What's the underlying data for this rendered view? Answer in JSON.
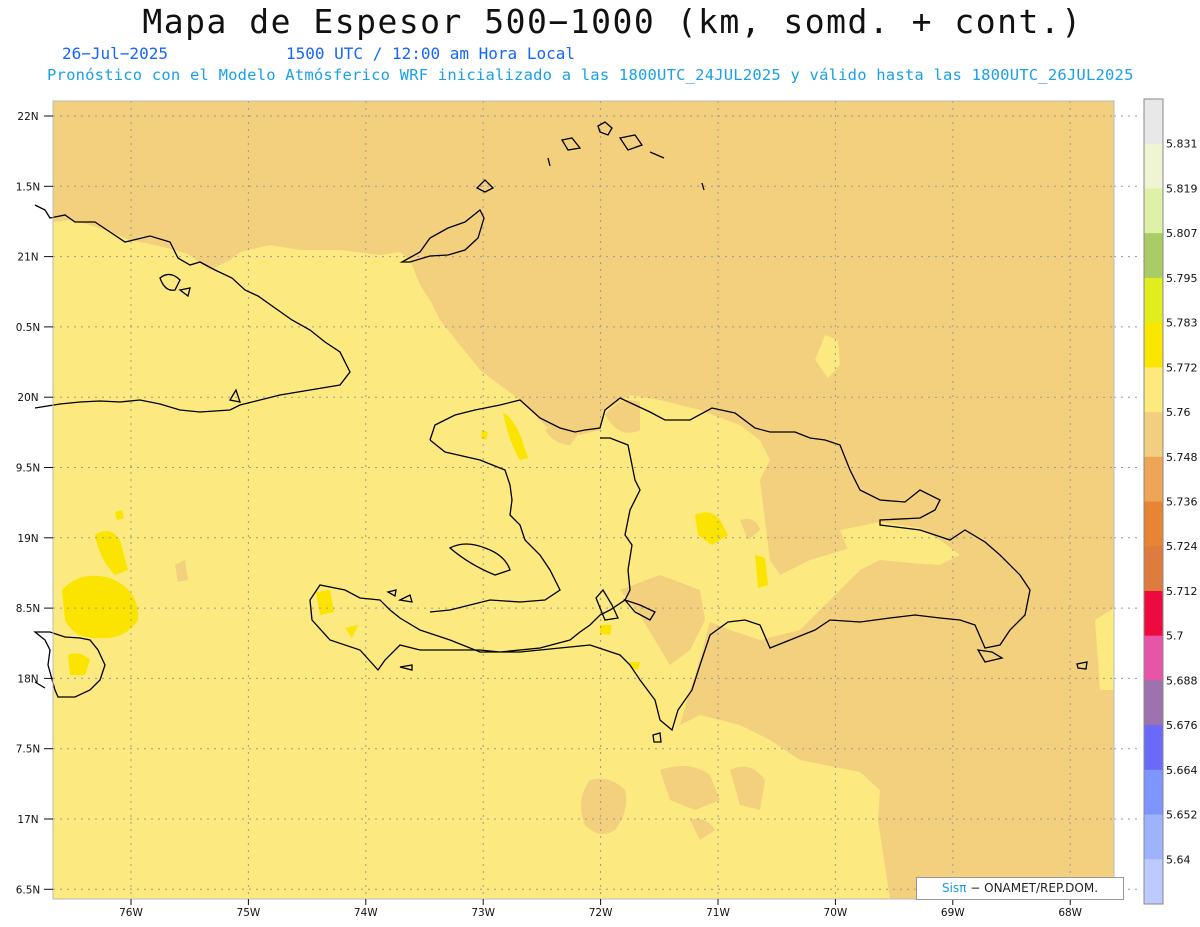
{
  "header": {
    "title": "Mapa de Espesor 500−1000 (km, somd. + cont.)",
    "date": "26−Jul−2025",
    "time": "1500 UTC / 12:00 am Hora Local",
    "info": "Pronóstico con el Modelo Atmósferico WRF inicializado a las 1800UTC_24JUL2025 y válido hasta las  1800UTC_26JUL2025"
  },
  "map": {
    "lat_labels": [
      "22N",
      "1.5N",
      "21N",
      "0.5N",
      "20N",
      "9.5N",
      "19N",
      "8.5N",
      "18N",
      "7.5N",
      "17N",
      "6.5N"
    ],
    "lon_labels": [
      "76W",
      "75W",
      "74W",
      "73W",
      "72W",
      "71W",
      "70W",
      "69W",
      "68W"
    ],
    "colors": {
      "band_5748_5760": "#f2d07e",
      "band_5760_5772": "#fce97f",
      "band_5772_5783": "#fbe400",
      "coastline": "#000000",
      "grid": "#888888"
    }
  },
  "colorbar": {
    "labels": [
      "5.831",
      "5.819",
      "5.807",
      "5.795",
      "5.783",
      "5.772",
      "5.76",
      "5.748",
      "5.736",
      "5.724",
      "5.712",
      "5.7",
      "5.688",
      "5.676",
      "5.664",
      "5.652",
      "5.64"
    ],
    "colors": [
      "#e8e8e8",
      "#eff5d2",
      "#dff1a6",
      "#a9cd64",
      "#e1ed1c",
      "#fbe600",
      "#fde97c",
      "#f2cf7f",
      "#eca655",
      "#e88535",
      "#dd7c3d",
      "#ee0a3e",
      "#e754a8",
      "#9c73ae",
      "#6a6afa",
      "#7e95fd",
      "#9eb2fd",
      "#bccaff"
    ]
  },
  "credit": {
    "brand": "Sisπ",
    "text": "− ONAMET/REP.DOM."
  }
}
